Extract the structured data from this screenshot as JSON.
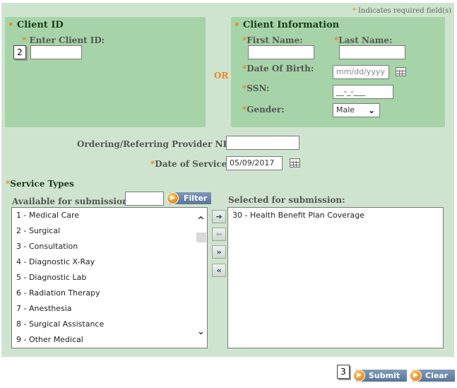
{
  "required_note": {
    "star": "*",
    "text": " Indicates required field(s)"
  },
  "client_id": {
    "heading": "Client ID",
    "label": "Enter Client ID:",
    "value": ""
  },
  "or_label": "OR",
  "client_info": {
    "heading": "Client Information",
    "first_name_label": "First Name:",
    "last_name_label": "Last Name:",
    "dob_label": "Date Of Birth:",
    "dob_placeholder": "mm/dd/yyyy",
    "ssn_label": "SSN:",
    "ssn_placeholder": "__-_-___",
    "gender_label": "Gender:",
    "gender_value": "Male"
  },
  "provider_npi_label": "Ordering/Referring Provider NPI:",
  "provider_npi_value": "",
  "date_of_service_label": "Date of Service:",
  "date_of_service_value": "05/09/2017",
  "service_types": {
    "heading": "Service Types",
    "available_label": "Available for submission:",
    "filter_label": "Filter",
    "selected_label": "Selected for submission:",
    "available": [
      "1 - Medical Care",
      "2 - Surgical",
      "3 - Consultation",
      "4 - Diagnostic X-Ray",
      "5 - Diagnostic Lab",
      "6 - Radiation Therapy",
      "7 - Anesthesia",
      "8 - Surgical Assistance",
      "9 - Other Medical"
    ],
    "selected": [
      "30 - Health Benefit Plan Coverage"
    ]
  },
  "badges": {
    "client_id": "2",
    "submit": "3"
  },
  "buttons": {
    "submit": "Submit",
    "clear": "Clear"
  },
  "icons": {
    "calendar": "calendar-icon",
    "move_right": "arrow-right-icon",
    "move_left": "arrow-left-icon",
    "move_all_right": "double-arrow-right-icon",
    "move_all_left": "double-arrow-left-icon",
    "chevron": "chevron-down-icon"
  },
  "colors": {
    "panel": "#cfe4cf",
    "box": "#a6d4a8",
    "accent": "#e8891e",
    "button": "#5a7699"
  }
}
